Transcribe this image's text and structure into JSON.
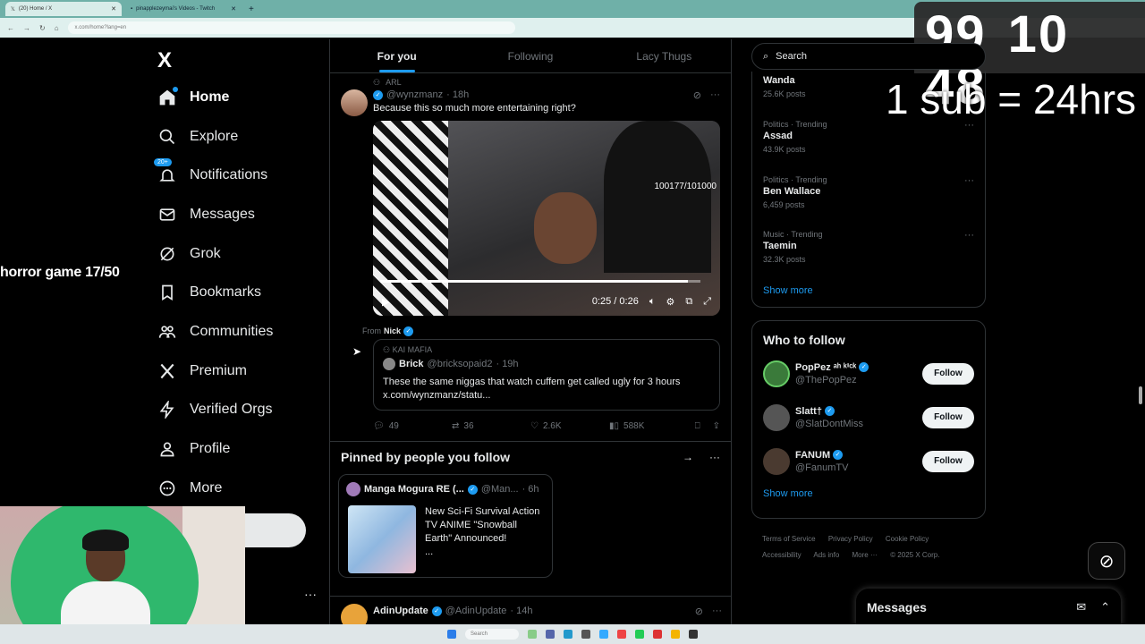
{
  "browser": {
    "tabs": [
      {
        "label": "(20) Home / X",
        "active": true
      },
      {
        "label": "pinapplezeymai's Videos - Twitch",
        "active": false
      }
    ],
    "url": "x.com/home?lang=en"
  },
  "overlay": {
    "timer": "99 10 48",
    "sub_rule": "1 sub = 24hrs",
    "horror": "horror game 17/50"
  },
  "nav": {
    "logo": "X",
    "notifications_badge": "20+",
    "items": [
      {
        "label": "Home",
        "icon": "home-icon"
      },
      {
        "label": "Explore",
        "icon": "search-icon"
      },
      {
        "label": "Notifications",
        "icon": "bell-icon"
      },
      {
        "label": "Messages",
        "icon": "mail-icon"
      },
      {
        "label": "Grok",
        "icon": "grok-icon"
      },
      {
        "label": "Bookmarks",
        "icon": "bookmark-icon"
      },
      {
        "label": "Communities",
        "icon": "people-icon"
      },
      {
        "label": "Premium",
        "icon": "x-icon"
      },
      {
        "label": "Verified Orgs",
        "icon": "bolt-icon"
      },
      {
        "label": "Profile",
        "icon": "person-icon"
      },
      {
        "label": "More",
        "icon": "more-circle-icon"
      }
    ]
  },
  "timeline": {
    "tabs": [
      "For you",
      "Following",
      "Lacy Thugs"
    ],
    "tweet1": {
      "source": "ARL",
      "handle": "@wynzmanz",
      "time": "· 18h",
      "text": "Because this so much more entertaining right?",
      "video": {
        "counter": "100177/101000",
        "time": "0:25 / 0:26",
        "progress": 0.96
      },
      "from_label": "From",
      "from_name": "Nick",
      "quote": {
        "source": "KAI MAFIA",
        "name": "Brick",
        "handle": "@bricksopaid2",
        "time": "· 19h",
        "text": "These the same niggas that watch cuffem get called ugly for 3 hours",
        "link": "x.com/wynzmanz/statu..."
      },
      "stats": {
        "replies": "49",
        "reposts": "36",
        "likes": "2.6K",
        "views": "588K"
      }
    },
    "pinned": {
      "title": "Pinned by people you follow",
      "card": {
        "name": "Manga Mogura RE (...",
        "handle": "@Man...",
        "time": "· 6h",
        "text": "New Sci-Fi Survival Action TV ANIME \"Snowball Earth\" Announced!",
        "ellipsis": "..."
      }
    },
    "tweet3": {
      "name": "AdinUpdate",
      "handle": "@AdinUpdate",
      "time": "· 14h"
    }
  },
  "sidebar": {
    "search_placeholder": "Search",
    "trends": [
      {
        "category": "",
        "name": "Wanda",
        "posts": "25.6K posts"
      },
      {
        "category": "Politics · Trending",
        "name": "Assad",
        "posts": "43.9K posts"
      },
      {
        "category": "Politics · Trending",
        "name": "Ben Wallace",
        "posts": "6,459 posts"
      },
      {
        "category": "Music · Trending",
        "name": "Taemin",
        "posts": "32.3K posts"
      }
    ],
    "trends_show_more": "Show more",
    "who_to_follow": {
      "title": "Who to follow",
      "accounts": [
        {
          "name": "PopPez ᵃʰ ᵏⁱᶜᵏ",
          "handle": "@ThePopPez",
          "button": "Follow",
          "color": "#3a7a3a"
        },
        {
          "name": "Slatt†",
          "handle": "@SlatDontMiss",
          "button": "Follow",
          "color": "#555555"
        },
        {
          "name": "FANUM",
          "handle": "@FanumTV",
          "button": "Follow",
          "color": "#4a3a30"
        }
      ],
      "show_more": "Show more"
    },
    "footer": [
      "Terms of Service",
      "Privacy Policy",
      "Cookie Policy",
      "Accessibility",
      "Ads info",
      "More ···",
      "© 2025 X Corp."
    ],
    "messages_title": "Messages"
  },
  "taskbar": {
    "search": "Search"
  },
  "colors": {
    "accent": "#1d9bf0",
    "background": "#000000",
    "text": "#e7e9ea",
    "muted": "#71767b",
    "border": "#2f3336"
  }
}
